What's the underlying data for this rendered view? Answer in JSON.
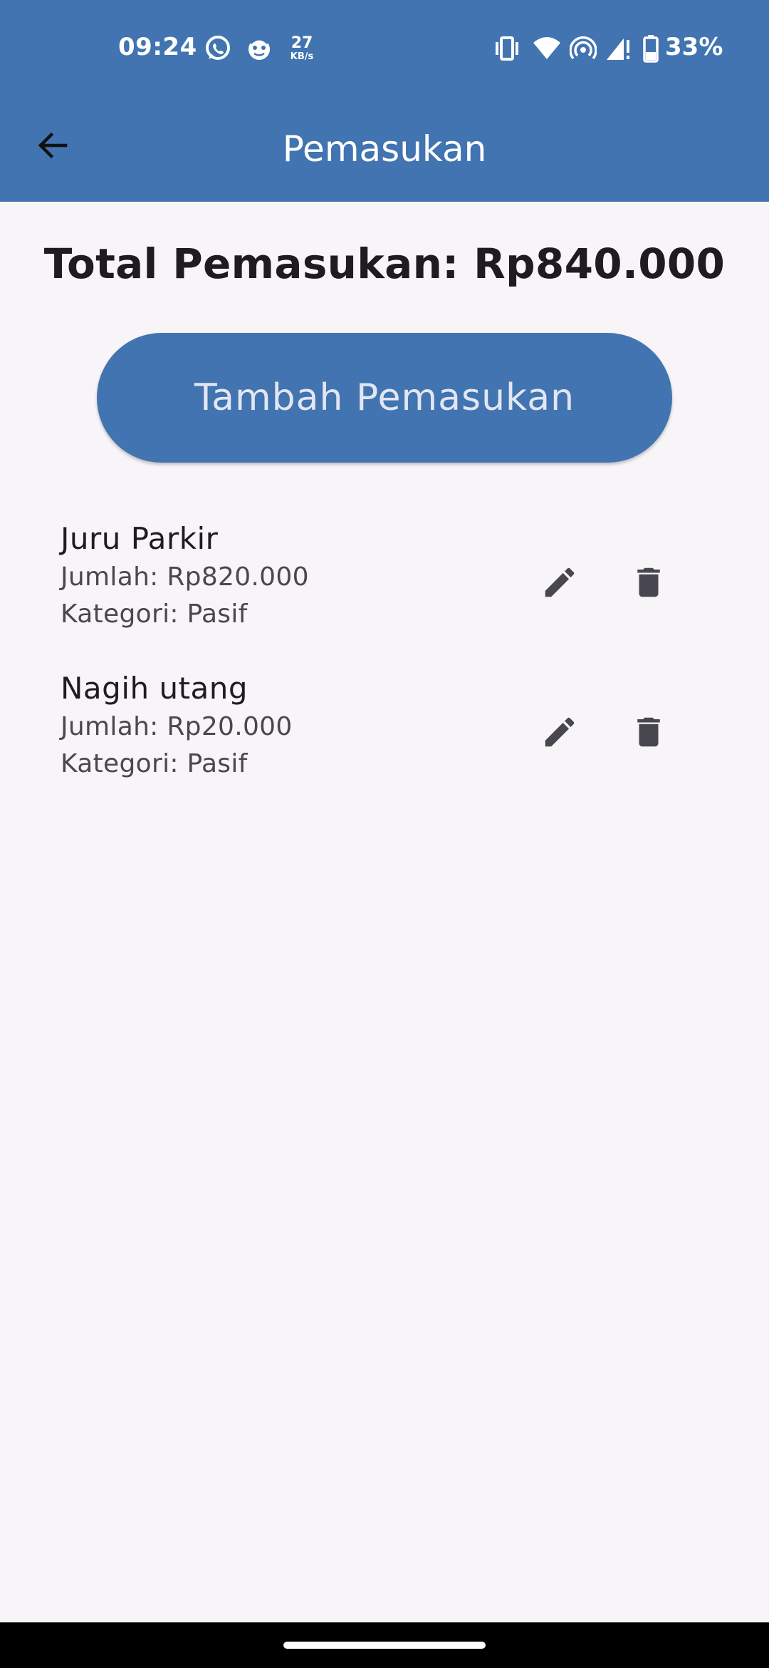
{
  "status_bar": {
    "time": "09:24",
    "net_speed_value": "27",
    "net_speed_unit": "KB/s",
    "battery_percent": "33%",
    "icons": [
      "whatsapp-icon",
      "app-notification-icon",
      "vibrate-icon",
      "wifi-icon",
      "hotspot-icon",
      "signal-icon",
      "battery-icon"
    ]
  },
  "app_bar": {
    "title": "Pemasukan",
    "back_icon": "arrow-back-icon",
    "color": "#4174b0"
  },
  "summary": {
    "total_label": "Total Pemasukan: Rp840.000"
  },
  "actions": {
    "add_label": "Tambah Pemasukan"
  },
  "income_items": [
    {
      "name": "Juru Parkir",
      "amount": "Jumlah: Rp820.000",
      "category": "Kategori: Pasif",
      "edit_icon": "pencil-icon",
      "delete_icon": "trash-icon"
    },
    {
      "name": "Nagih utang",
      "amount": "Jumlah: Rp20.000",
      "category": "Kategori: Pasif",
      "edit_icon": "pencil-icon",
      "delete_icon": "trash-icon"
    }
  ],
  "colors": {
    "primary": "#4174b0",
    "background": "#f7f5f7",
    "button_text": "#e2e6f2",
    "icon": "#48464f"
  }
}
